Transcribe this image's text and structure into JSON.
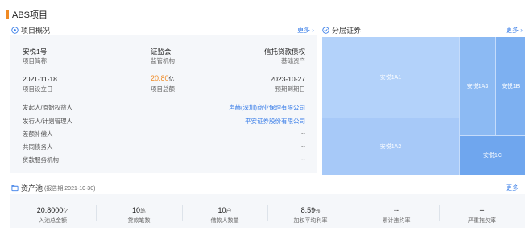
{
  "title": "ABS项目",
  "overview": {
    "header": "项目概况",
    "more": "更多",
    "project_name": "安悦1号",
    "project_name_label": "项目简称",
    "regulator": "证监会",
    "regulator_label": "监管机构",
    "asset_type": "信托贷款债权",
    "asset_type_label": "基础资产",
    "setup_date": "2021-11-18",
    "setup_date_label": "项目设立日",
    "total_amount": "20.80",
    "total_amount_unit": "亿",
    "total_amount_label": "项目总额",
    "maturity_date": "2023-10-27",
    "maturity_date_label": "预期到期日",
    "parties": [
      {
        "label": "发起人/原始权益人",
        "value": "声赫(深圳)商业保理有限公司",
        "link": true
      },
      {
        "label": "发行人/计划管理人",
        "value": "平安证券股份有限公司",
        "link": true
      },
      {
        "label": "差额补偿人",
        "value": "--",
        "link": false
      },
      {
        "label": "共同债务人",
        "value": "--",
        "link": false
      },
      {
        "label": "贷款服务机构",
        "value": "--",
        "link": false
      }
    ]
  },
  "tranches": {
    "header": "分层证券",
    "more": "更多",
    "items": [
      "安悦1A1",
      "安悦1A2",
      "安悦1A3",
      "安悦1B",
      "安悦1C"
    ]
  },
  "pool": {
    "header": "资产池",
    "report_date": "(报告期:2021-10-30)",
    "more": "更多",
    "stats": [
      {
        "value": "20.8000",
        "unit": "亿",
        "label": "入池总金额"
      },
      {
        "value": "10",
        "unit": "笔",
        "label": "贷款笔数"
      },
      {
        "value": "10",
        "unit": "户",
        "label": "借款人数量"
      },
      {
        "value": "8.59",
        "unit": "%",
        "label": "加权平均利率"
      },
      {
        "value": "--",
        "unit": "",
        "label": "累计违约率"
      },
      {
        "value": "--",
        "unit": "",
        "label": "严重拖欠率"
      }
    ]
  },
  "colors": {
    "accent": "#f08a24",
    "link": "#3a7ee8",
    "tile_a1": "#b3d2fa",
    "tile_a2": "#a7c9f8",
    "tile_a3": "#8cbaf3",
    "tile_b": "#7db0f1",
    "tile_c": "#6fa6ee"
  }
}
